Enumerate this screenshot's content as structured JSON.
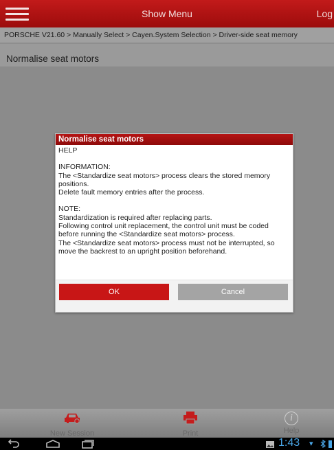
{
  "header": {
    "title": "Show Menu",
    "login_label": "Log"
  },
  "breadcrumb": "PORSCHE V21.60 > Manually Select > Cayen.System Selection > Driver-side seat memory",
  "page_title": "Normalise seat motors",
  "dialog": {
    "title": "Normalise seat motors",
    "help": "HELP",
    "info_heading": "INFORMATION:",
    "info_line1": "The <Standardize seat motors> process clears the stored memory positions.",
    "info_line2": "Delete fault memory entries after the process.",
    "note_heading": "NOTE:",
    "note_line1": "Standardization is required after replacing parts.",
    "note_line2": "Following control unit replacement, the control unit must be coded before running the <Standardize seat motors> process.",
    "note_line3": "The <Standardize seat motors> process must not be interrupted, so move the backrest to an upright position beforehand.",
    "ok_label": "OK",
    "cancel_label": "Cancel"
  },
  "toolbar": {
    "new_session_label": "New Session",
    "print_label": "Print",
    "help_label": "Help"
  },
  "status_bar": {
    "time": "1:43"
  },
  "colors": {
    "accent": "#c21a1a",
    "status_blue": "#4aa6e6"
  }
}
